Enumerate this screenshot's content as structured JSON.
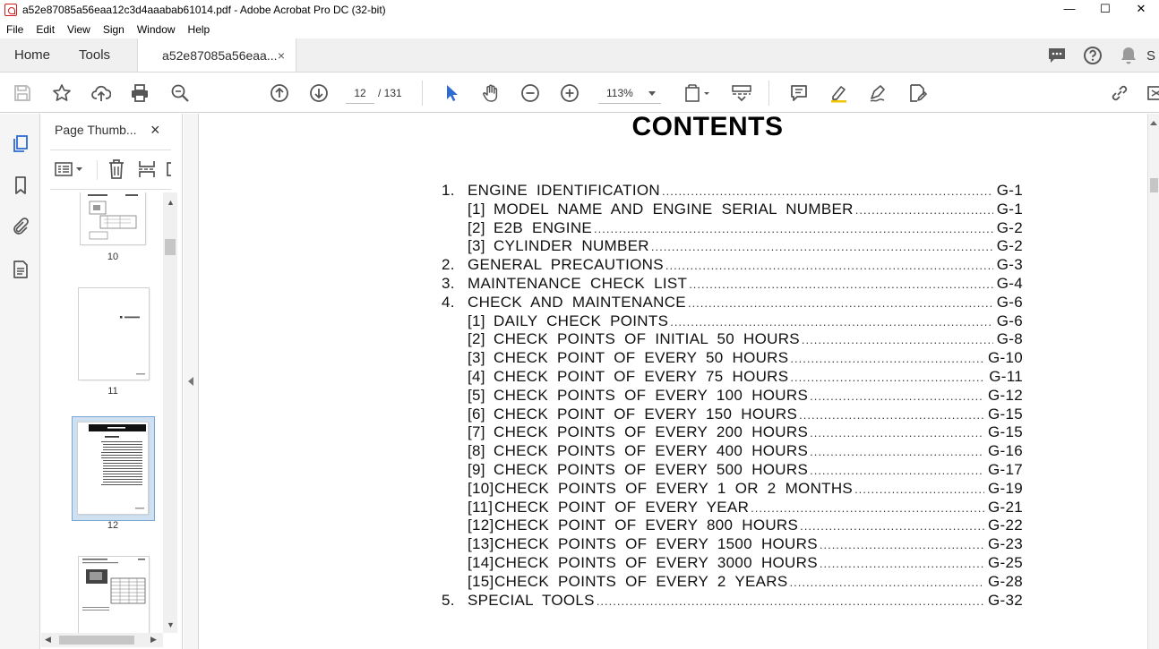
{
  "window": {
    "title": "a52e87085a56eaa12c3d4aaabab61014.pdf - Adobe Acrobat Pro DC (32-bit)",
    "minimize": "—",
    "maximize": "☐",
    "close": "✕"
  },
  "menu": [
    "File",
    "Edit",
    "View",
    "Sign",
    "Window",
    "Help"
  ],
  "tabs": {
    "home": "Home",
    "tools": "Tools",
    "document": "a52e87085a56eaa...",
    "close": "×",
    "sign_label": "S"
  },
  "toolbar": {
    "current_page": "12",
    "page_total": "/ 131",
    "zoom": "113%"
  },
  "thumbnail_panel": {
    "title": "Page Thumb...",
    "close": "×",
    "pages": [
      "10",
      "11",
      "12"
    ],
    "selected_page": "12"
  },
  "document": {
    "title": "CONTENTS",
    "entries": [
      {
        "num": "1.",
        "sub": "",
        "text": "ENGINE IDENTIFICATION",
        "page": "G-1"
      },
      {
        "num": "",
        "sub": "[1]",
        "text": "MODEL NAME AND ENGINE SERIAL NUMBER",
        "page": "G-1"
      },
      {
        "num": "",
        "sub": "[2]",
        "text": "E2B ENGINE",
        "page": "G-2"
      },
      {
        "num": "",
        "sub": "[3]",
        "text": "CYLINDER NUMBER",
        "page": "G-2"
      },
      {
        "num": "2.",
        "sub": "",
        "text": "GENERAL PRECAUTIONS",
        "page": "G-3"
      },
      {
        "num": "3.",
        "sub": "",
        "text": "MAINTENANCE CHECK LIST",
        "page": "G-4"
      },
      {
        "num": "4.",
        "sub": "",
        "text": "CHECK AND MAINTENANCE",
        "page": "G-6"
      },
      {
        "num": "",
        "sub": "[1]",
        "text": "DAILY CHECK POINTS",
        "page": "G-6"
      },
      {
        "num": "",
        "sub": "[2]",
        "text": "CHECK POINTS OF INITIAL 50 HOURS",
        "page": "G-8"
      },
      {
        "num": "",
        "sub": "[3]",
        "text": "CHECK POINT OF EVERY 50 HOURS",
        "page": "G-10"
      },
      {
        "num": "",
        "sub": "[4]",
        "text": "CHECK POINT OF EVERY 75 HOURS",
        "page": "G-11"
      },
      {
        "num": "",
        "sub": "[5]",
        "text": "CHECK POINTS OF EVERY 100 HOURS",
        "page": "G-12"
      },
      {
        "num": "",
        "sub": "[6]",
        "text": "CHECK POINT OF EVERY 150 HOURS",
        "page": "G-15"
      },
      {
        "num": "",
        "sub": "[7]",
        "text": "CHECK POINTS OF EVERY 200 HOURS",
        "page": "G-15"
      },
      {
        "num": "",
        "sub": "[8]",
        "text": "CHECK POINTS OF EVERY 400 HOURS",
        "page": "G-16"
      },
      {
        "num": "",
        "sub": "[9]",
        "text": "CHECK POINTS OF EVERY 500 HOURS",
        "page": "G-17"
      },
      {
        "num": "",
        "sub": "[10]",
        "text": "CHECK POINTS OF EVERY 1 OR 2 MONTHS",
        "page": "G-19"
      },
      {
        "num": "",
        "sub": "[11]",
        "text": "CHECK POINT OF EVERY YEAR",
        "page": "G-21"
      },
      {
        "num": "",
        "sub": "[12]",
        "text": "CHECK POINT OF EVERY 800 HOURS",
        "page": "G-22"
      },
      {
        "num": "",
        "sub": "[13]",
        "text": "CHECK POINTS OF EVERY 1500 HOURS",
        "page": "G-23"
      },
      {
        "num": "",
        "sub": "[14]",
        "text": "CHECK POINTS OF EVERY 3000 HOURS",
        "page": "G-25"
      },
      {
        "num": "",
        "sub": "[15]",
        "text": "CHECK POINTS OF EVERY 2 YEARS",
        "page": "G-28"
      },
      {
        "num": "5.",
        "sub": "",
        "text": "SPECIAL TOOLS",
        "page": "G-32"
      }
    ]
  },
  "colors": {
    "accent_blue": "#2d6bd1",
    "icon_gray": "#555555",
    "selection_blue": "#cfe0f1",
    "acrobat_red": "#d21a1a"
  },
  "icons": {
    "toolbar": [
      "save-icon",
      "bookmark-star-icon",
      "upload-icon",
      "print-icon",
      "zoom-search-icon",
      "page-up-icon",
      "page-down-icon",
      "select-arrow-icon",
      "hand-icon",
      "zoom-out-icon",
      "zoom-in-icon",
      "page-fit-icon",
      "scroll-mode-icon",
      "comment-icon",
      "highlight-icon",
      "sign-icon",
      "edit-pdf-icon",
      "share-link-icon"
    ],
    "rail": [
      "thumbnails-icon",
      "bookmarks-icon",
      "attachments-icon",
      "layers-icon"
    ]
  }
}
